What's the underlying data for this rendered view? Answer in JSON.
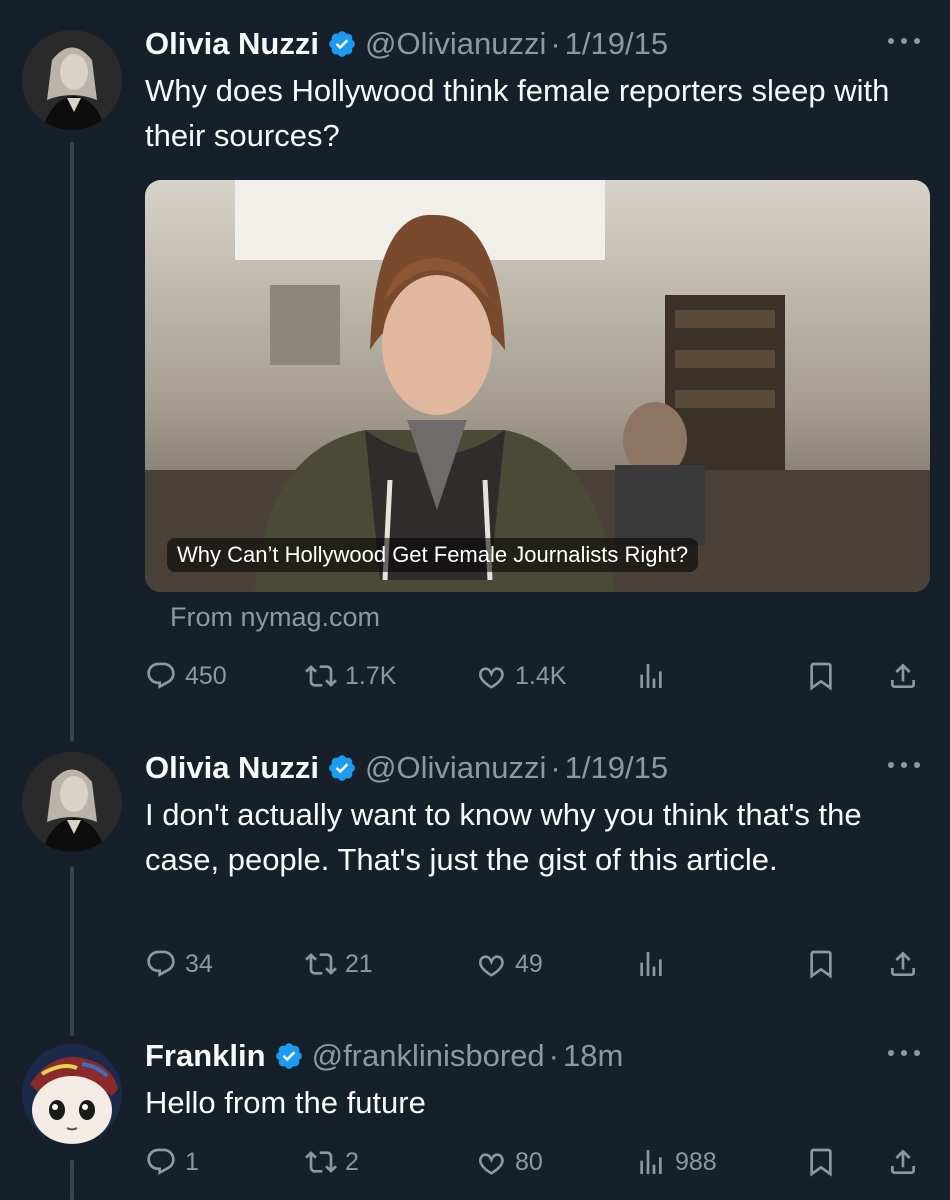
{
  "tweets": [
    {
      "author": "Olivia Nuzzi",
      "handle": "@Olivianuzzi",
      "time": "1/19/15",
      "text": "Why does Hollywood think female reporters sleep with their sources?",
      "card": {
        "caption": "Why Can’t Hollywood Get Female Journalists Right?",
        "source": "From nymag.com"
      },
      "stats": {
        "replies": "450",
        "reposts": "1.7K",
        "likes": "1.4K",
        "views": ""
      }
    },
    {
      "author": "Olivia Nuzzi",
      "handle": "@Olivianuzzi",
      "time": "1/19/15",
      "text": "I don't actually want to know why you think that's the case, people. That's just the gist of this article.",
      "stats": {
        "replies": "34",
        "reposts": "21",
        "likes": "49",
        "views": ""
      }
    },
    {
      "author": "Franklin",
      "handle": "@franklinisbored",
      "time": "18m",
      "text": "Hello from the future",
      "stats": {
        "replies": "1",
        "reposts": "2",
        "likes": "80",
        "views": "988"
      }
    }
  ],
  "separator": "·",
  "icons": [
    "verified-icon",
    "more-icon",
    "reply-icon",
    "repost-icon",
    "like-icon",
    "views-icon",
    "bookmark-icon",
    "share-icon"
  ],
  "colors": {
    "background": "#15202b",
    "text": "#f7f9f9",
    "muted": "#8b98a5",
    "verified": "#1d9bf0",
    "thread_line": "#38444d"
  }
}
